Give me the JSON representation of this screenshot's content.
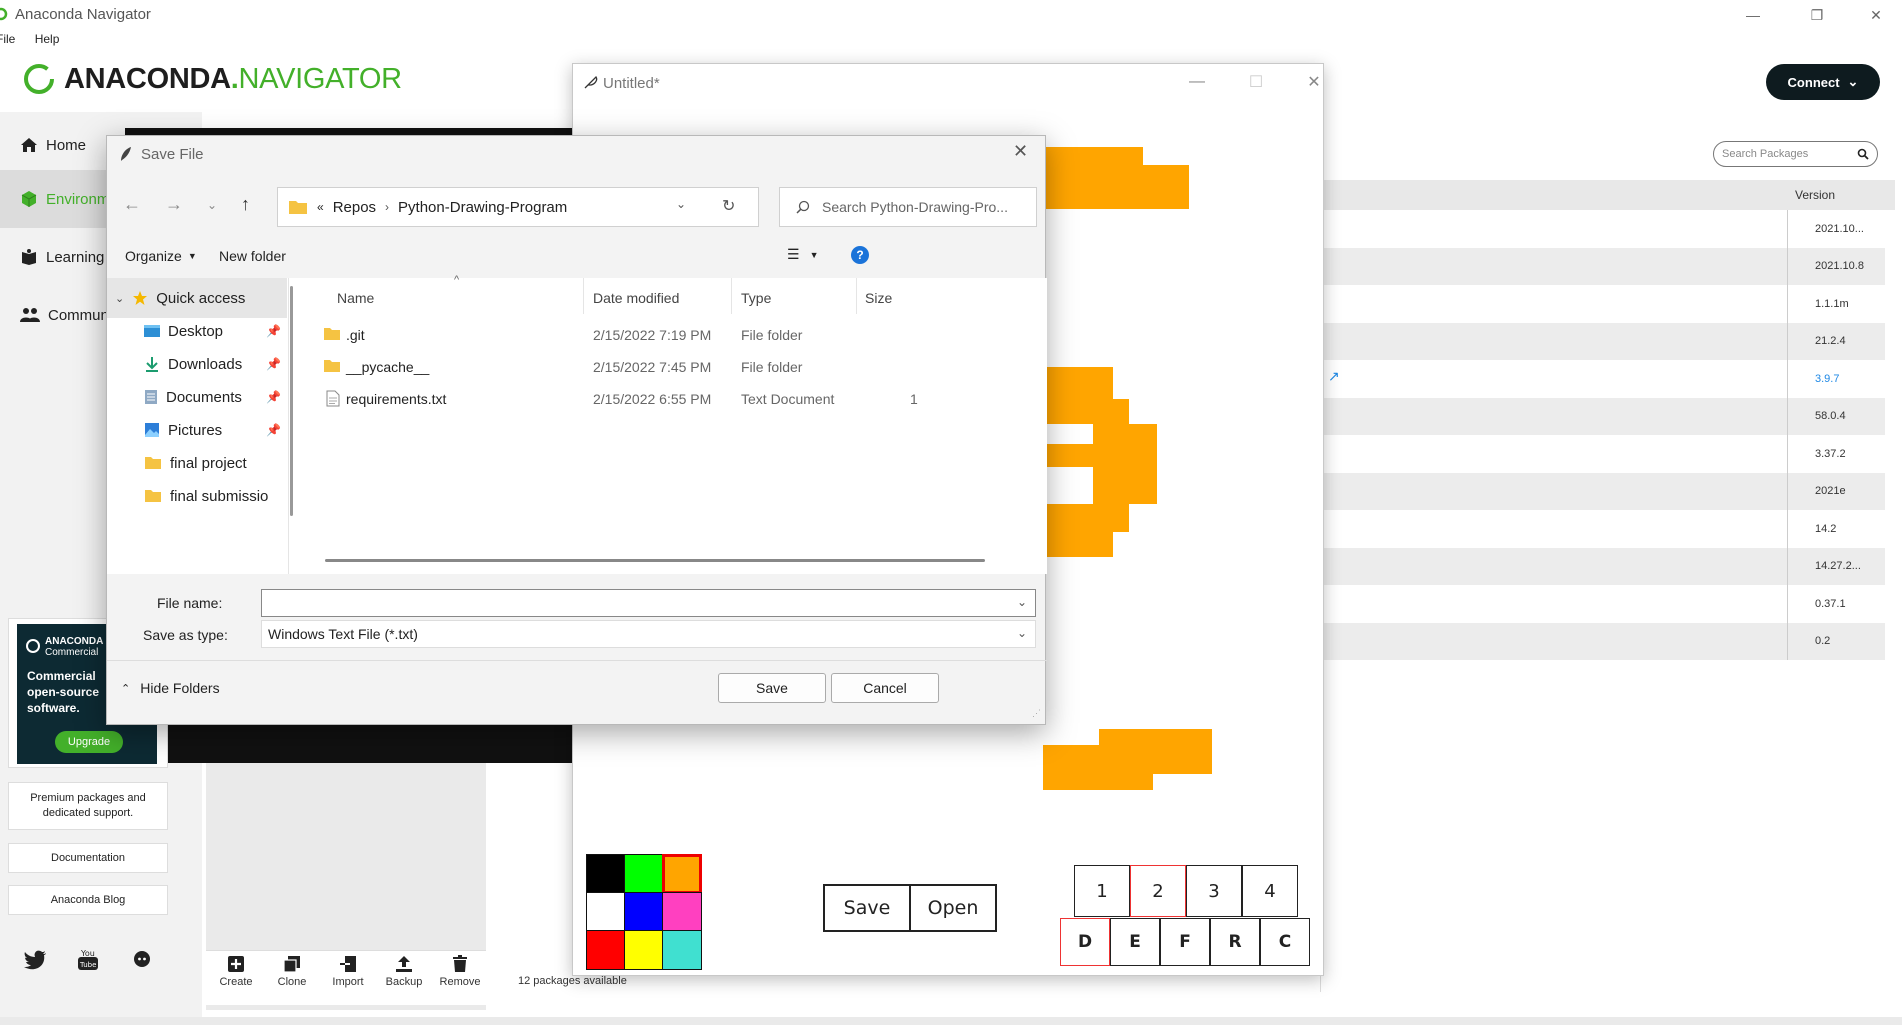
{
  "app": {
    "window_title": "Anaconda Navigator",
    "menu": [
      "File",
      "Help"
    ],
    "logo_primary": "ANACONDA",
    "logo_secondary": "NAVIGATOR",
    "connect_label": "Connect",
    "nav": [
      {
        "label": "Home",
        "icon": "home-icon"
      },
      {
        "label": "Environments",
        "icon": "cube-icon"
      },
      {
        "label": "Learning",
        "icon": "book-icon"
      },
      {
        "label": "Community",
        "icon": "people-icon"
      }
    ],
    "promo": {
      "brand": "ANACONDA",
      "brand_sub": "Commercial",
      "text": "Commercial open-source software.",
      "upgrade": "Upgrade"
    },
    "premium_text": "Premium packages and dedicated support.",
    "documentation": "Documentation",
    "blog": "Anaconda Blog",
    "env_tools": [
      "Create",
      "Clone",
      "Import",
      "Backup",
      "Remove"
    ],
    "search_placeholder": "Search Packages",
    "version_header": "Version",
    "versions": [
      "2021.10...",
      "2021.10.8",
      "1.1.1m",
      "21.2.4",
      "3.9.7",
      "58.0.4",
      "3.37.2",
      "2021e",
      "14.2",
      "14.27.2...",
      "0.37.1",
      "0.2"
    ],
    "package_count": "12 packages available"
  },
  "drawing": {
    "title": "Untitled*",
    "save": "Save",
    "open": "Open",
    "numbers": [
      "1",
      "2",
      "3",
      "4"
    ],
    "letters": [
      "D",
      "E",
      "F",
      "R",
      "C"
    ],
    "palette": [
      "#000000",
      "#00ff00",
      "#ffa500",
      "#ffffff",
      "#0000ff",
      "#ff40c0",
      "#ff0000",
      "#ffff00",
      "#40e0d0"
    ]
  },
  "dialog": {
    "title": "Save File",
    "path": [
      "Repos",
      "Python-Drawing-Program"
    ],
    "search_placeholder": "Search Python-Drawing-Pro...",
    "organize": "Organize",
    "new_folder": "New folder",
    "tree": [
      {
        "label": "Quick access",
        "icon": "star-icon"
      },
      {
        "label": "Desktop",
        "icon": "desktop-icon"
      },
      {
        "label": "Downloads",
        "icon": "download-icon"
      },
      {
        "label": "Documents",
        "icon": "document-icon"
      },
      {
        "label": "Pictures",
        "icon": "picture-icon"
      },
      {
        "label": "final project",
        "icon": "folder-icon"
      },
      {
        "label": "final submissio",
        "icon": "folder-icon"
      }
    ],
    "columns": [
      "Name",
      "Date modified",
      "Type",
      "Size"
    ],
    "files": [
      {
        "name": ".git",
        "date": "2/15/2022 7:19 PM",
        "type": "File folder",
        "size": "",
        "icon": "folder-icon"
      },
      {
        "name": "__pycache__",
        "date": "2/15/2022 7:45 PM",
        "type": "File folder",
        "size": "",
        "icon": "folder-icon"
      },
      {
        "name": "requirements.txt",
        "date": "2/15/2022 6:55 PM",
        "type": "Text Document",
        "size": "1",
        "icon": "text-file-icon"
      }
    ],
    "file_name_label": "File name:",
    "file_name_value": "",
    "save_type_label": "Save as type:",
    "save_type_value": "Windows Text File (*.txt)",
    "hide_folders": "Hide Folders",
    "save": "Save",
    "cancel": "Cancel"
  },
  "colors": {
    "accent_green": "#43b02a",
    "orange": "#ffa500",
    "dark": "#0e1b1f"
  }
}
